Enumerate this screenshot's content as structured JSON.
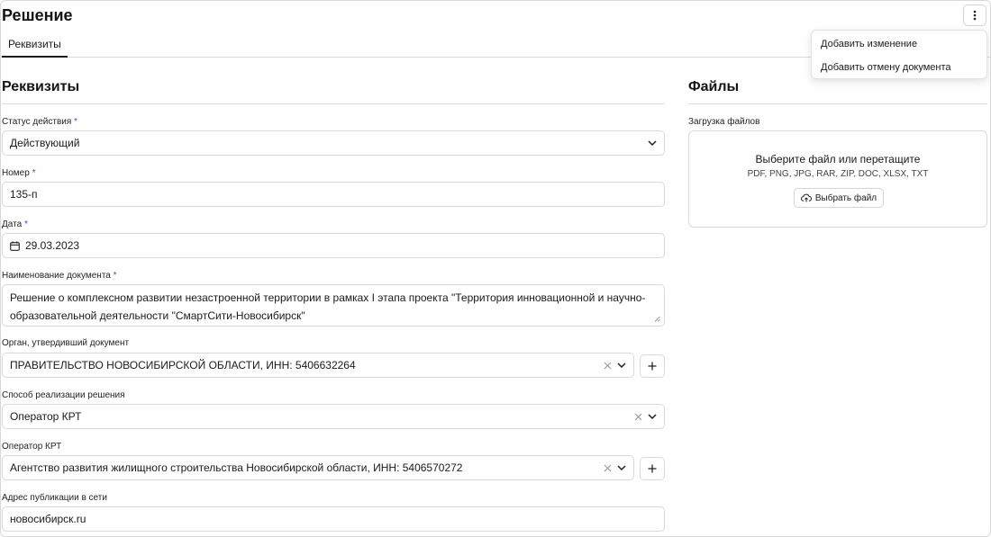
{
  "header": {
    "title": "Решение",
    "menu_icon": "more-vertical-icon"
  },
  "tabs": [
    {
      "label": "Реквизиты",
      "active": true
    }
  ],
  "context_menu": {
    "items": [
      {
        "label": "Добавить изменение"
      },
      {
        "label": "Добавить отмену документа"
      }
    ]
  },
  "requisites": {
    "section_title": "Реквизиты",
    "status": {
      "label": "Статус действия",
      "required_mark": "*",
      "value": "Действующий"
    },
    "number": {
      "label": "Номер",
      "required_mark": "*",
      "value": "135-п"
    },
    "date": {
      "label": "Дата",
      "required_mark": "*",
      "value": "29.03.2023"
    },
    "doc_name": {
      "label": "Наименование документа",
      "required_mark": "*",
      "value": "Решение о комплексном развитии незастроенной территории в рамках I этапа проекта \"Территория инновационной и научно-образовательной деятельности \"СмартСити-Новосибирск\""
    },
    "authority": {
      "label": "Орган, утвердивший документ",
      "value": "ПРАВИТЕЛЬСТВО НОВОСИБИРСКОЙ ОБЛАСТИ, ИНН: 5406632264"
    },
    "method": {
      "label": "Способ реализации решения",
      "value": "Оператор КРТ"
    },
    "operator": {
      "label": "Оператор КРТ",
      "value": "Агентство развития жилищного строительства Новосибирской области, ИНН: 5406570272"
    },
    "address": {
      "label": "Адрес публикации в сети",
      "value": "новосибирск.ru"
    }
  },
  "files": {
    "section_title": "Файлы",
    "upload_label": "Загрузка файлов",
    "dropzone_title": "Выберите файл или перетащите",
    "dropzone_formats": "PDF, PNG, JPG, RAR, ZIP, DOC, XLSX, TXT",
    "choose_button": "Выбрать файл"
  },
  "colors": {
    "required_mark": "#2d57d8",
    "border": "#d9d9d9",
    "text": "#1a1a1a"
  }
}
